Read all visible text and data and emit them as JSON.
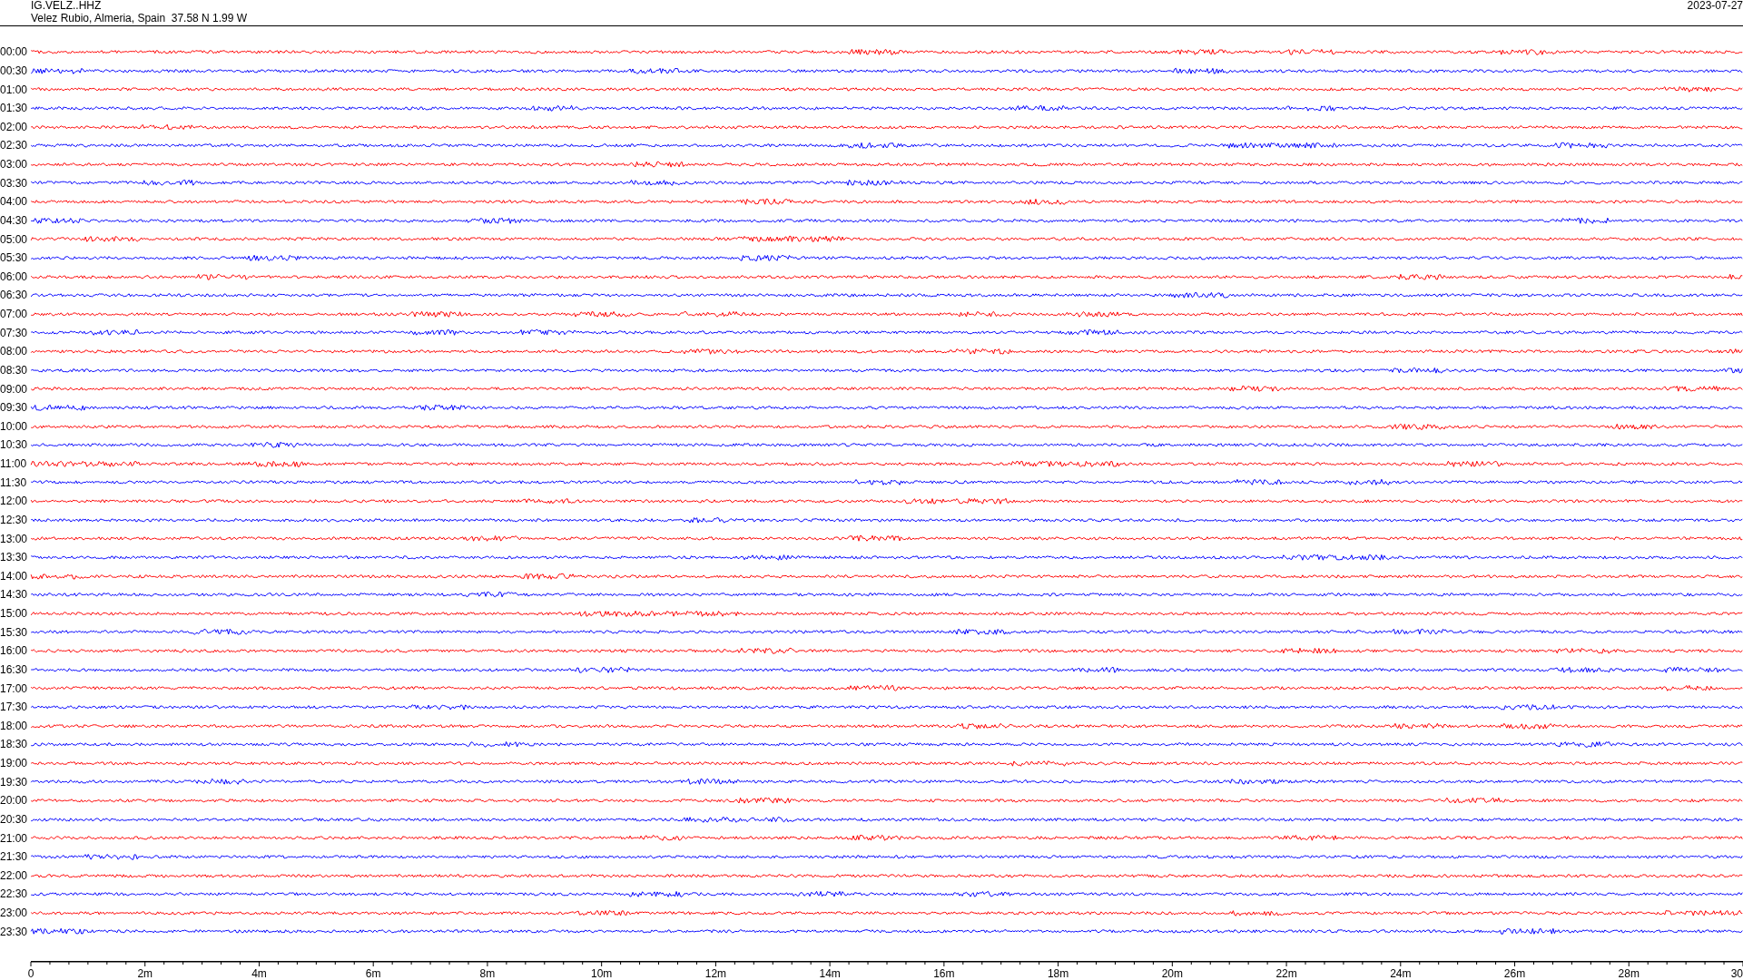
{
  "header": {
    "station": "IG.VELZ..HHZ",
    "location": "Velez Rubio, Almeria, Spain  37.58 N 1.99 W",
    "date": "2023-07-27"
  },
  "rows": [
    {
      "label": "00:00",
      "color": "#ff0000"
    },
    {
      "label": "00:30",
      "color": "#0000ff"
    },
    {
      "label": "01:00",
      "color": "#ff0000"
    },
    {
      "label": "01:30",
      "color": "#0000ff"
    },
    {
      "label": "02:00",
      "color": "#ff0000"
    },
    {
      "label": "02:30",
      "color": "#0000ff"
    },
    {
      "label": "03:00",
      "color": "#ff0000"
    },
    {
      "label": "03:30",
      "color": "#0000ff"
    },
    {
      "label": "04:00",
      "color": "#ff0000"
    },
    {
      "label": "04:30",
      "color": "#0000ff"
    },
    {
      "label": "05:00",
      "color": "#ff0000"
    },
    {
      "label": "05:30",
      "color": "#0000ff"
    },
    {
      "label": "06:00",
      "color": "#ff0000"
    },
    {
      "label": "06:30",
      "color": "#0000ff"
    },
    {
      "label": "07:00",
      "color": "#ff0000"
    },
    {
      "label": "07:30",
      "color": "#0000ff"
    },
    {
      "label": "08:00",
      "color": "#ff0000"
    },
    {
      "label": "08:30",
      "color": "#0000ff"
    },
    {
      "label": "09:00",
      "color": "#ff0000"
    },
    {
      "label": "09:30",
      "color": "#0000ff"
    },
    {
      "label": "10:00",
      "color": "#ff0000"
    },
    {
      "label": "10:30",
      "color": "#0000ff"
    },
    {
      "label": "11:00",
      "color": "#ff0000"
    },
    {
      "label": "11:30",
      "color": "#0000ff"
    },
    {
      "label": "12:00",
      "color": "#ff0000"
    },
    {
      "label": "12:30",
      "color": "#0000ff"
    },
    {
      "label": "13:00",
      "color": "#ff0000"
    },
    {
      "label": "13:30",
      "color": "#0000ff"
    },
    {
      "label": "14:00",
      "color": "#ff0000"
    },
    {
      "label": "14:30",
      "color": "#0000ff"
    },
    {
      "label": "15:00",
      "color": "#ff0000"
    },
    {
      "label": "15:30",
      "color": "#0000ff"
    },
    {
      "label": "16:00",
      "color": "#ff0000"
    },
    {
      "label": "16:30",
      "color": "#0000ff"
    },
    {
      "label": "17:00",
      "color": "#ff0000"
    },
    {
      "label": "17:30",
      "color": "#0000ff"
    },
    {
      "label": "18:00",
      "color": "#ff0000"
    },
    {
      "label": "18:30",
      "color": "#0000ff"
    },
    {
      "label": "19:00",
      "color": "#ff0000"
    },
    {
      "label": "19:30",
      "color": "#0000ff"
    },
    {
      "label": "20:00",
      "color": "#ff0000"
    },
    {
      "label": "20:30",
      "color": "#0000ff"
    },
    {
      "label": "21:00",
      "color": "#ff0000"
    },
    {
      "label": "21:30",
      "color": "#0000ff"
    },
    {
      "label": "22:00",
      "color": "#ff0000"
    },
    {
      "label": "22:30",
      "color": "#0000ff"
    },
    {
      "label": "23:00",
      "color": "#ff0000"
    },
    {
      "label": "23:30",
      "color": "#0000ff"
    }
  ],
  "time_axis": {
    "labels": [
      "0",
      "2m",
      "4m",
      "6m",
      "8m",
      "10m",
      "12m",
      "14m",
      "16m",
      "18m",
      "20m",
      "22m",
      "24m",
      "26m",
      "28m",
      "30"
    ]
  }
}
